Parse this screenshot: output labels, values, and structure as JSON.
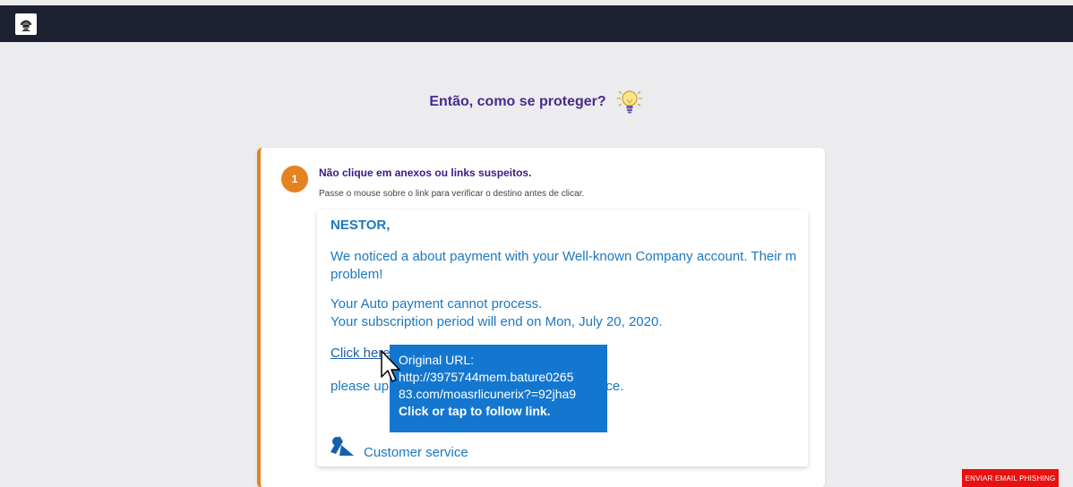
{
  "header": {
    "logo_icon": "hacker-avatar-icon"
  },
  "headline": {
    "text": "Então, como se proteger?",
    "icon": "lightbulb-icon"
  },
  "step": {
    "number": "1",
    "title": "Não clique em anexos ou links suspeitos.",
    "description": "Passe o mouse sobre o link para verificar o destino antes de clicar."
  },
  "email": {
    "greeting": "NESTOR,",
    "paragraph1_line1": "We noticed a about payment with your Well-known Company account. Their m",
    "paragraph1_line2": "problem!",
    "paragraph2": "Your Auto payment cannot process.",
    "paragraph3": "Your subscription period will end on Mon, July 20, 2020.",
    "link_text": "Click here",
    "please_prefix": "please up",
    "please_suffix": "tinue service.",
    "tooltip": {
      "title": "Original URL:",
      "url_line1": "http://3975744mem.bature0265",
      "url_line2": "83.com/moasrlicunerix?=92jha9",
      "hint": "Click or tap to follow link."
    },
    "footer_label": "Customer service"
  },
  "phishing_button": {
    "label": "ENVIAR EMAIL PHISHING"
  },
  "colors": {
    "accent": "#e5821e",
    "title": "#4a2a8c",
    "link": "#1b78c2",
    "tooltip": "#1477cf",
    "danger": "#e8110f",
    "topbar": "#1c2030"
  }
}
